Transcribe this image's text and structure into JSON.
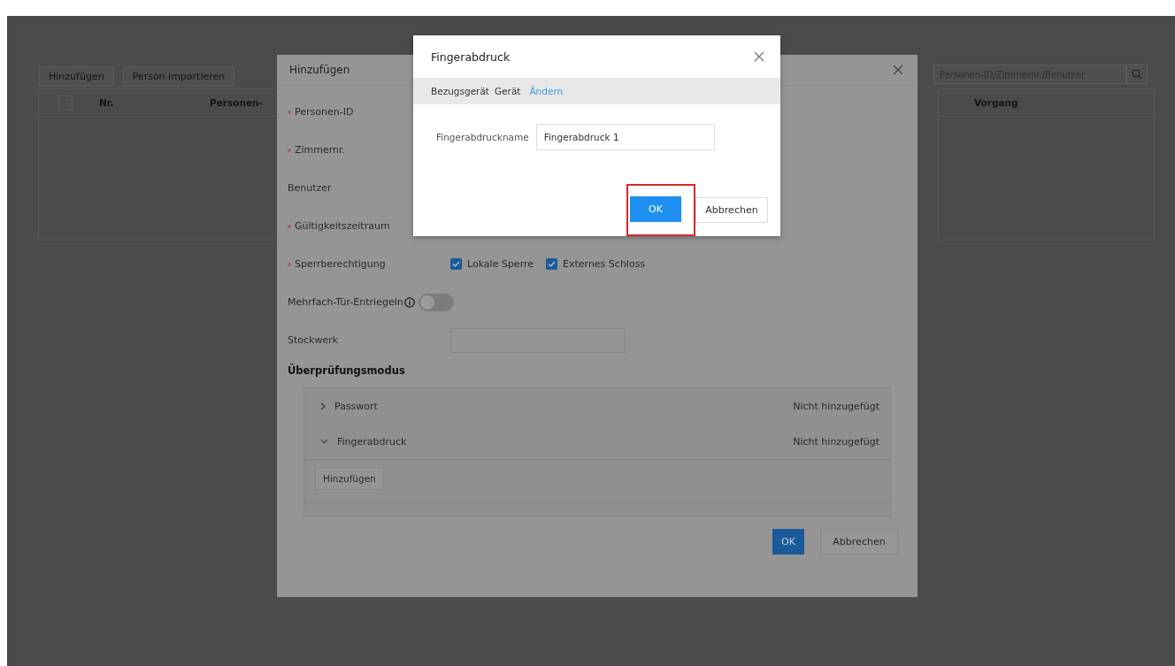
{
  "page": {
    "toolbar_buttons": [
      "Hinzufügen",
      "Person importieren"
    ],
    "search": {
      "placeholder": "Personen-ID/Zimmernr./Benutzer"
    },
    "table": {
      "select_all_checked": false,
      "columns": [
        "Nr.",
        "Personen-",
        "Vorgang"
      ]
    }
  },
  "add_dialog": {
    "title": "Hinzufügen",
    "fields": [
      {
        "kind": "plain",
        "label": "Personen-ID",
        "required": true
      },
      {
        "kind": "plain",
        "label": "Zimmernr.",
        "required": true
      },
      {
        "kind": "plain",
        "label": "Benutzer",
        "required": false
      },
      {
        "kind": "plain",
        "label": "Gültigkeitszeitraum",
        "required": true
      },
      {
        "kind": "checkboxes",
        "label": "Sperrberechtigung",
        "required": true,
        "options": [
          {
            "label": "Lokale Sperre",
            "checked": true
          },
          {
            "label": "Externes Schloss",
            "checked": true
          }
        ]
      },
      {
        "kind": "toggle",
        "label": "Mehrfach-Tür-Entriegeln",
        "required": false,
        "on": false
      },
      {
        "kind": "input",
        "label": "Stockwerk",
        "required": false
      }
    ],
    "section_title": "Überprüfungsmodus",
    "modes": [
      {
        "name": "Passwort",
        "status": "Nicht hinzugefügt",
        "expanded": false
      },
      {
        "name": "Fingerabdruck",
        "status": "Nicht hinzugefügt",
        "expanded": true,
        "add_button": "Hinzufügen"
      }
    ],
    "buttons": [
      "OK",
      "Abbrechen"
    ]
  },
  "fingerprint_dialog": {
    "title": "Fingerabdruck",
    "device_label": "Bezugsgerät",
    "device": "Gerät",
    "change_link": "Ändern",
    "name_label": "Fingerabdruckname",
    "name_value": "Fingerabdruck 1",
    "buttons": [
      {
        "label": "OK",
        "highlighted": true
      },
      {
        "label": "Abbrechen",
        "highlighted": false
      }
    ]
  }
}
